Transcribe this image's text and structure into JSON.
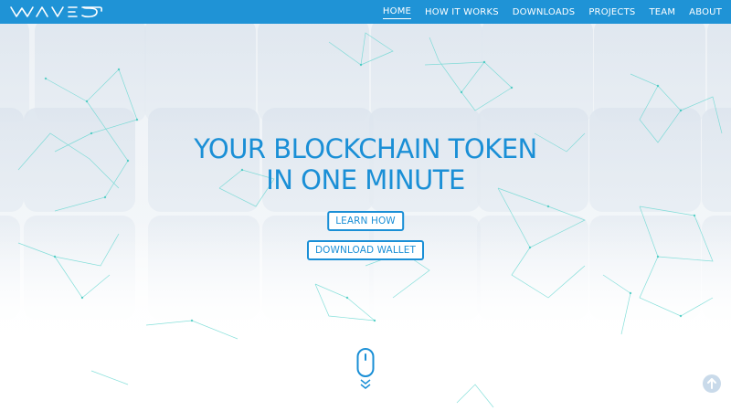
{
  "header": {
    "logo_icon": "waves-logo",
    "nav": [
      "HOME",
      "HOW IT WORKS",
      "DOWNLOADS",
      "PROJECTS",
      "TEAM",
      "ABOUT"
    ],
    "active_item": "HOME"
  },
  "hero": {
    "title_line1": "YOUR BLOCKCHAIN TOKEN",
    "title_line2": "IN ONE MINUTE",
    "learn_button": "LEARN HOW",
    "download_button": "DOWNLOAD WALLET"
  },
  "icons": {
    "scroll": "mouse-scroll-icon",
    "back_to_top": "arrow-up-circle-icon"
  },
  "colors": {
    "nav_bg": "#1f93d6",
    "accent": "#1a8fd6",
    "network": "#5fd6cf"
  }
}
